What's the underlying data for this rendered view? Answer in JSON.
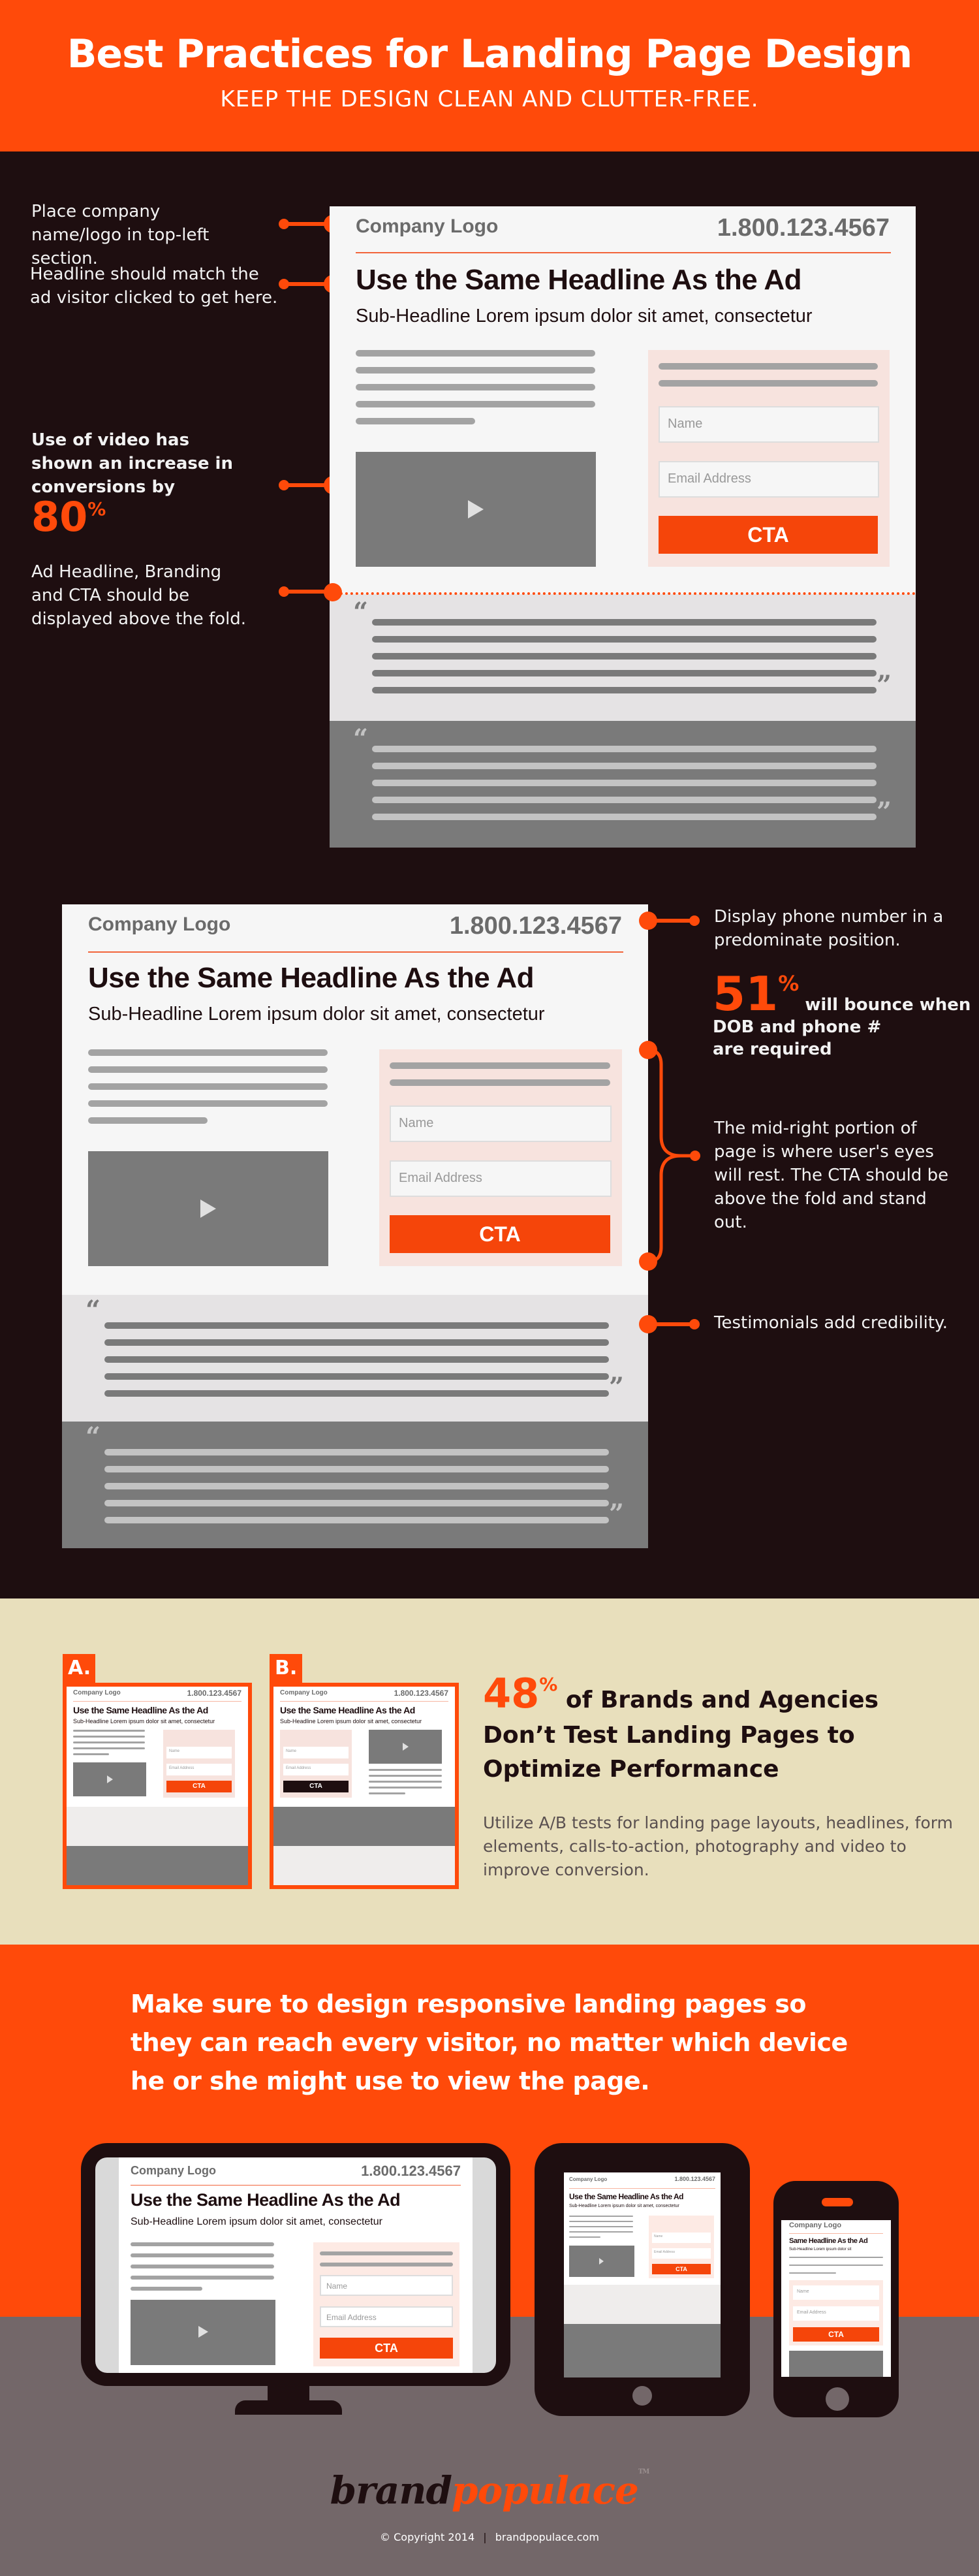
{
  "header": {
    "title": "Best Practices for Landing Page Design",
    "subtitle": "KEEP THE DESIGN CLEAN AND CLUTTER-FREE."
  },
  "colors": {
    "accent": "#ff4a0a",
    "dark": "#1e0e10",
    "beige": "#e8dfbc",
    "footer_gray": "#736769",
    "mock_bg": "#f6f6f6",
    "form_bg": "#f7e3de"
  },
  "mock": {
    "logo": "Company Logo",
    "phone": "1.800.123.4567",
    "headline": "Use the Same Headline As the Ad",
    "subheadline": "Sub-Headline Lorem ipsum dolor sit amet, consectetur",
    "name_placeholder": "Name",
    "email_placeholder": "Email Address",
    "cta": "CTA",
    "quote_open": "“",
    "quote_close": "”",
    "mobile_headline": "Same Headline As the Ad",
    "mobile_subheadline": "Sub-Headline Lorem ipsum dolor sit"
  },
  "section1": {
    "notes": {
      "logo": "Place company name/logo in top-left section.",
      "headline": "Headline should match the ad visitor clicked to get here.",
      "video_prefix": "Use of video has shown an increase in conversions by",
      "video_stat": "80",
      "video_pct": "%",
      "fold": "Ad Headline, Branding and CTA should be displayed above the fold."
    }
  },
  "section2": {
    "notes": {
      "phone": "Display phone number in a predominate position.",
      "bounce_stat": "51",
      "bounce_pct": "%",
      "bounce_text_1": "will bounce when",
      "bounce_text_2": "DOB and phone #",
      "bounce_text_3": "are required",
      "midright": "The mid-right portion of page is where user's eyes will rest. The CTA should be above the fold and stand out.",
      "testimonials": "Testimonials add credibility."
    }
  },
  "section3": {
    "variant_a": "A.",
    "variant_b": "B.",
    "stat": "48",
    "pct": "%",
    "headline_1": "of Brands and Agencies",
    "headline_2": "Don’t Test Landing Pages to",
    "headline_3": "Optimize Performance",
    "body": "Utilize A/B tests for landing page layouts, headlines, form elements, calls-to-action, photography and video to improve conversion."
  },
  "section4": {
    "message": "Make sure to design responsive landing pages so they can reach every visitor, no matter which device he or she might use to view the page."
  },
  "footer": {
    "brand_1": "brand",
    "brand_2": "populace",
    "tm": "TM",
    "copyright": "© Copyright 2014",
    "separator": "|",
    "website": "brandpopulace.com"
  }
}
